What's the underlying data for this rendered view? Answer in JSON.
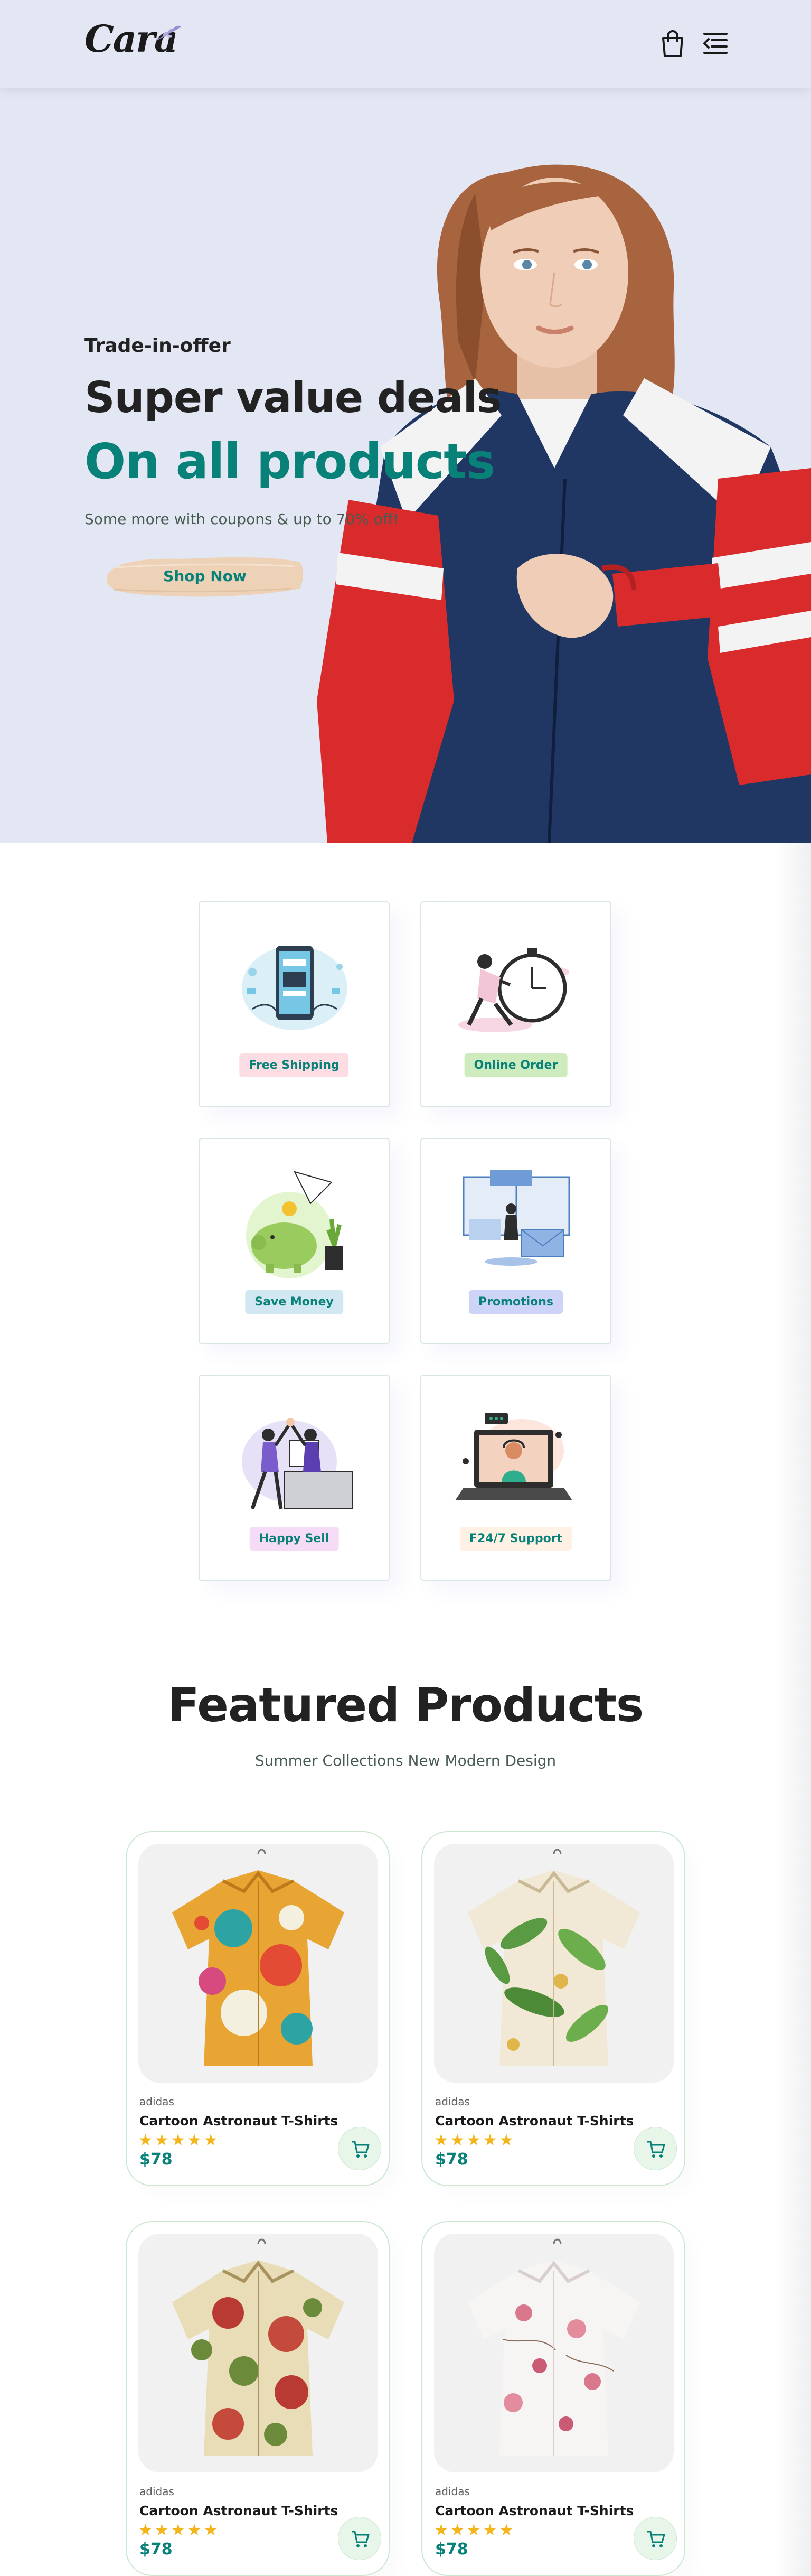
{
  "header": {
    "logo_text": "Cara",
    "icons": [
      "shopping-bag-icon",
      "menu-icon"
    ]
  },
  "hero": {
    "kicker": "Trade-in-offer",
    "headline": "Super value deals",
    "highlight": "On all products",
    "subtext": "Some more with coupons & up to 70% off!",
    "cta_label": "Shop Now"
  },
  "features": [
    {
      "label": "Free Shipping",
      "tag_color": "#fddde4"
    },
    {
      "label": "Online Order",
      "tag_color": "#cdebbc"
    },
    {
      "label": "Save Money",
      "tag_color": "#d1e8f2"
    },
    {
      "label": "Promotions",
      "tag_color": "#cdd4f8"
    },
    {
      "label": "Happy Sell",
      "tag_color": "#f6dbf6"
    },
    {
      "label": "F24/7 Support",
      "tag_color": "#fff2e5"
    }
  ],
  "featured": {
    "title": "Featured Products",
    "subtitle": "Summer Collections New Modern Design"
  },
  "products": [
    {
      "brand": "adidas",
      "name": "Cartoon Astronaut T-Shirts",
      "rating": "★★★★★",
      "price": "$78"
    },
    {
      "brand": "adidas",
      "name": "Cartoon Astronaut T-Shirts",
      "rating": "★★★★★",
      "price": "$78"
    },
    {
      "brand": "adidas",
      "name": "Cartoon Astronaut T-Shirts",
      "rating": "★★★★★",
      "price": "$78"
    },
    {
      "brand": "adidas",
      "name": "Cartoon Astronaut T-Shirts",
      "rating": "★★★★★",
      "price": "$78"
    }
  ],
  "colors": {
    "accent": "#088178",
    "hero_bg": "#e3e6f3",
    "star": "#f3b519",
    "cart_bg": "#e8f6ea"
  }
}
